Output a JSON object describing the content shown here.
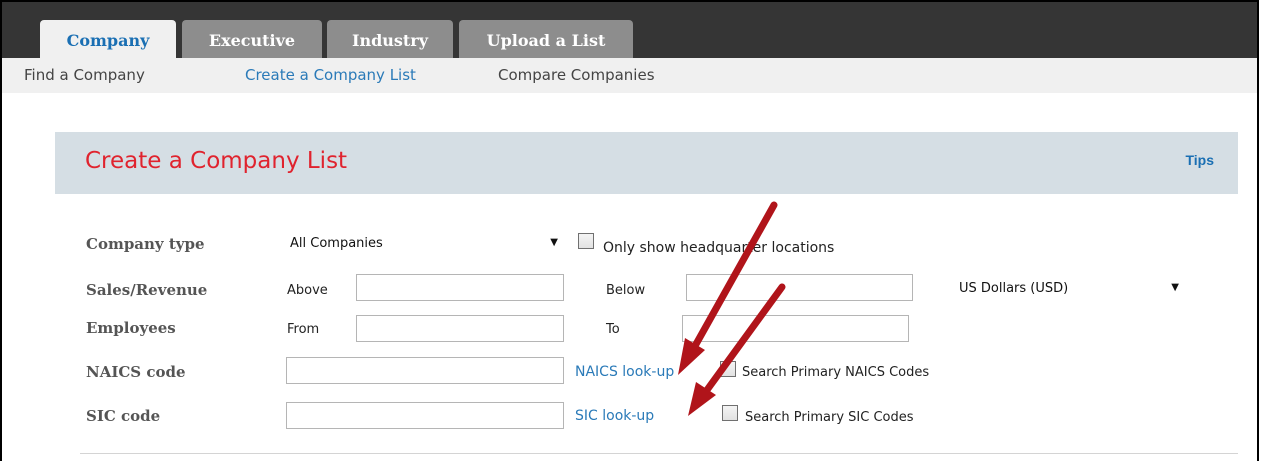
{
  "tabs": [
    {
      "label": "Company",
      "active": true
    },
    {
      "label": "Executive",
      "active": false
    },
    {
      "label": "Industry",
      "active": false
    },
    {
      "label": "Upload a List",
      "active": false
    }
  ],
  "subnav": [
    "Find a Company",
    "Create a Company List",
    "Compare Companies"
  ],
  "panel": {
    "title": "Create a Company List",
    "tips": "Tips"
  },
  "form": {
    "company_type": {
      "label": "Company type",
      "value": "All Companies",
      "checkbox": "Only show headquarter locations"
    },
    "sales": {
      "label": "Sales/Revenue",
      "above": "Above",
      "below": "Below",
      "currency": "US Dollars (USD)"
    },
    "employees": {
      "label": "Employees",
      "from": "From",
      "to": "To"
    },
    "naics": {
      "label": "NAICS code",
      "lookup": "NAICS look-up",
      "checkbox": "Search Primary NAICS Codes"
    },
    "sic": {
      "label": "SIC code",
      "lookup": "SIC look-up",
      "checkbox": "Search Primary SIC Codes"
    }
  },
  "colors": {
    "title": "#e0232e",
    "link": "#2a7ab8",
    "arrow": "#b0141a"
  }
}
